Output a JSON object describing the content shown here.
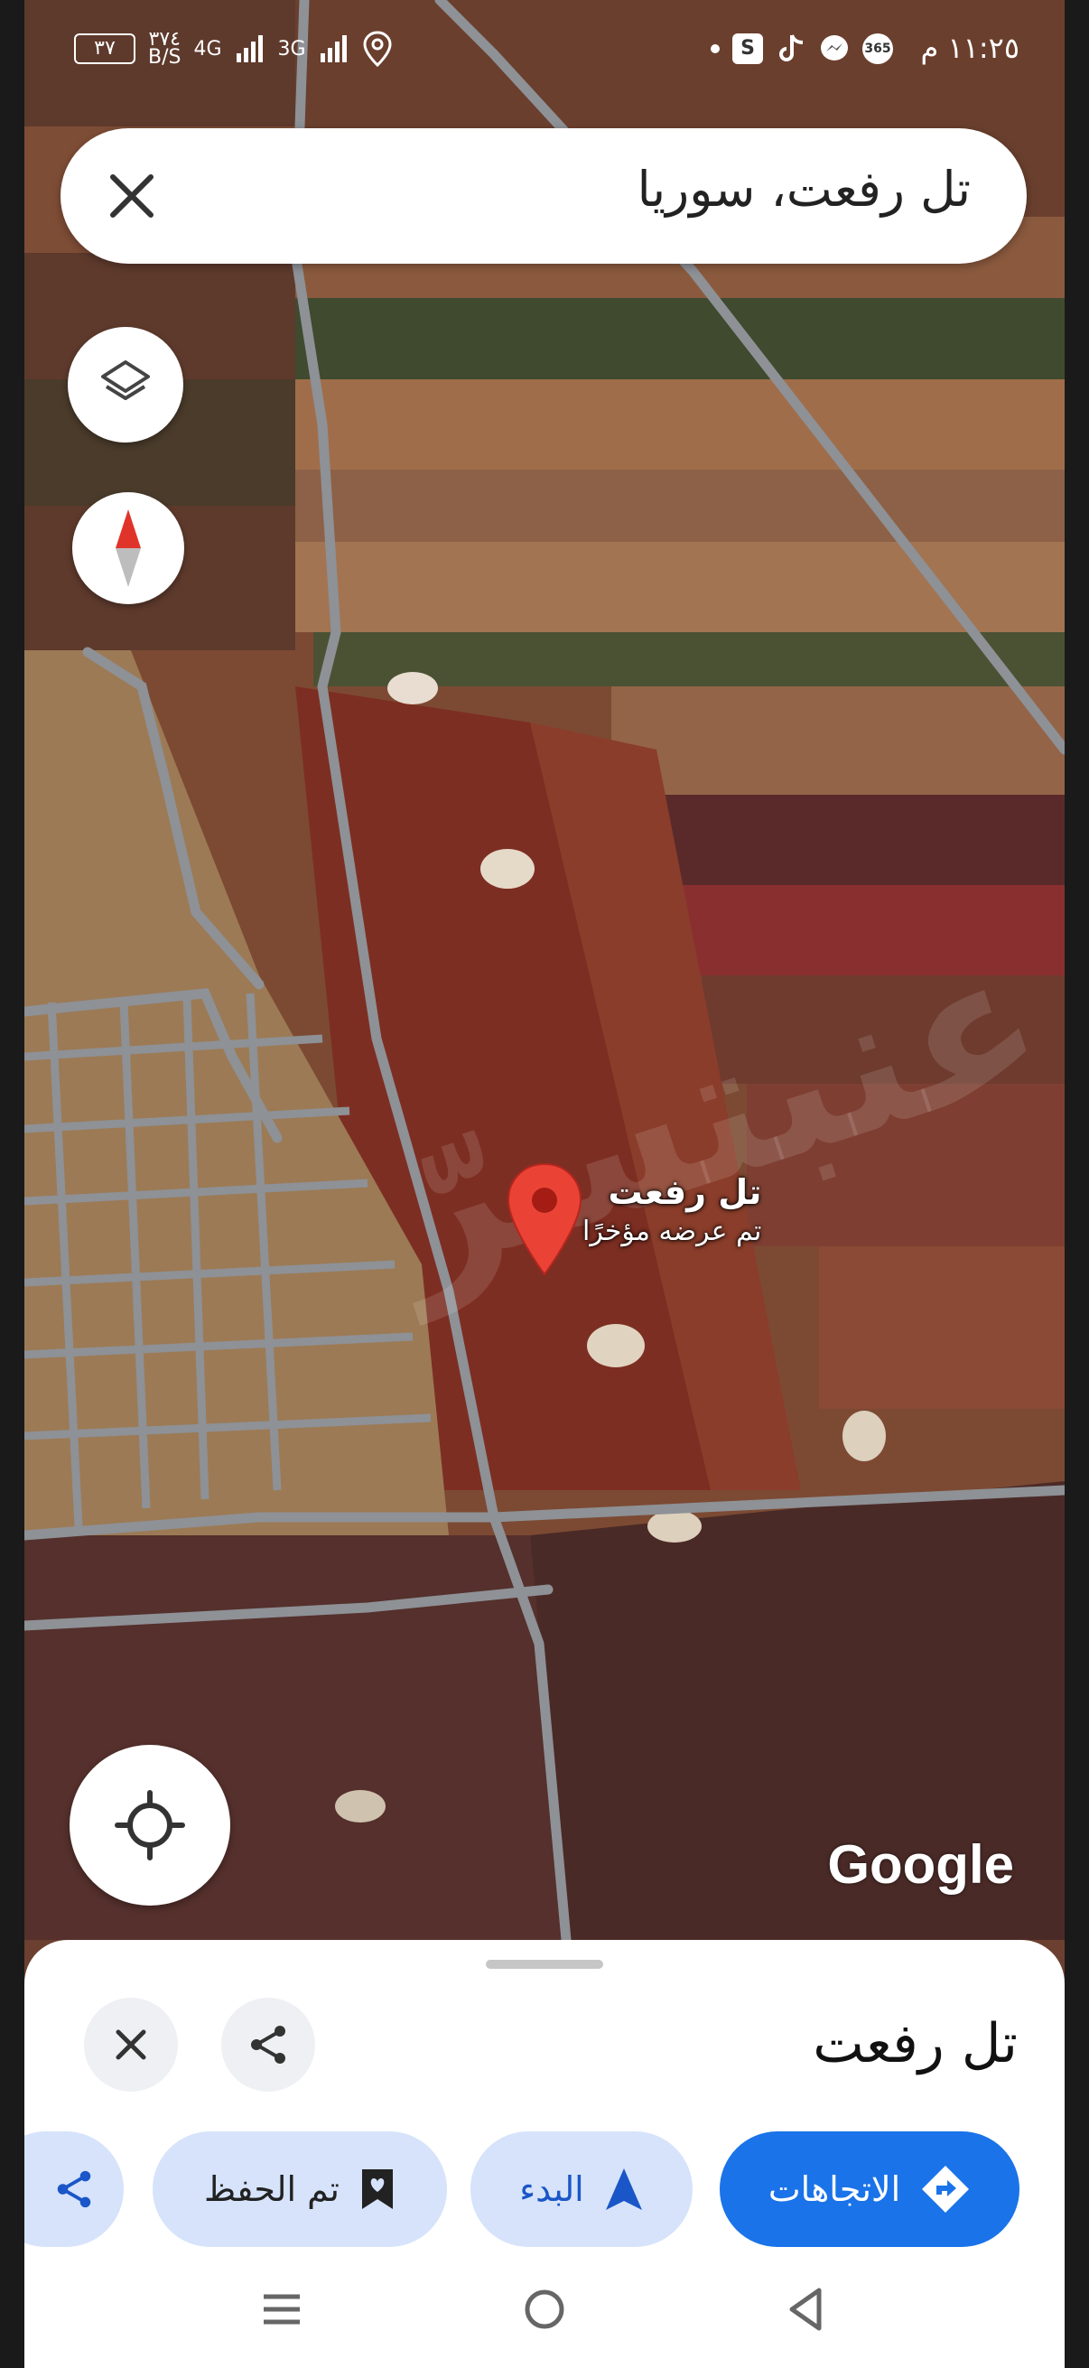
{
  "status_bar": {
    "time": "١١:٢٥ م",
    "battery": "٣٧",
    "speed_top": "٣٧٤",
    "speed_bottom": "B/S",
    "net1": "4G",
    "net2": "3G",
    "app_icons": [
      "dot",
      "s-icon",
      "tiktok-icon",
      "messenger-icon",
      "hd-icon"
    ]
  },
  "search": {
    "query": "تل رفعت، سوريا"
  },
  "map": {
    "pin_title": "تل رفعت",
    "pin_subtitle": "تم عرضه مؤخرًا",
    "watermark": "عنبتسرّ",
    "attribution": "Google"
  },
  "sheet": {
    "title": "تل رفعت",
    "chips": {
      "directions": "الاتجاهات",
      "start": "البدء",
      "saved": "تم الحفظ"
    }
  },
  "colors": {
    "accent": "#1a73e8",
    "chip_bg": "#d6e3fb",
    "pin_red": "#ea4335"
  }
}
